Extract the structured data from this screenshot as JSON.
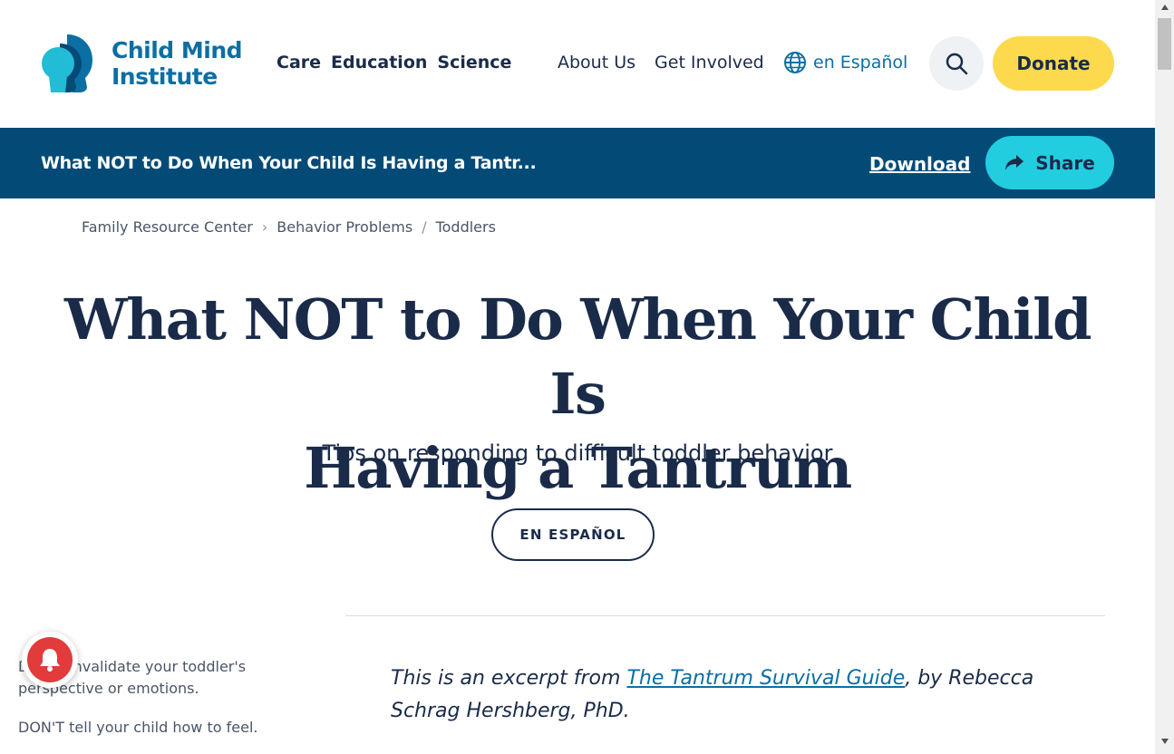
{
  "header": {
    "logo": {
      "line1": "Child Mind",
      "line2": "Institute",
      "icon": "child-mind-logo-icon"
    },
    "nav_main": [
      "Care",
      "Education",
      "Science"
    ],
    "nav_secondary": [
      "About Us",
      "Get Involved"
    ],
    "language_link": "en Español",
    "donate_label": "Donate",
    "colors": {
      "logo": "#0b6fa3",
      "donate_bg": "#fdd94e"
    }
  },
  "article_bar": {
    "title": "What NOT to Do When Your Child Is Having a Tantr...",
    "download_label": "Download",
    "share_label": "Share",
    "colors": {
      "bar_bg": "#034b76",
      "share_bg": "#22cde0"
    }
  },
  "breadcrumb": [
    "Family Resource Center",
    "Behavior Problems",
    "Toddlers"
  ],
  "article": {
    "title_line1": "What NOT to Do When Your Child Is",
    "title_line2": "Having a Tantrum",
    "subtitle": "Tips on responding to difficult toddler behavior",
    "espanol_button": "EN ESPAÑOL",
    "excerpt_prefix": "This is an excerpt from ",
    "excerpt_link": "The Tantrum Survival Guide",
    "excerpt_suffix": ", by Rebecca Schrag Hershberg, PhD."
  },
  "side_tips": [
    "DON'T invalidate your toddler's perspective or emotions.",
    "DON'T tell your child how to feel."
  ]
}
